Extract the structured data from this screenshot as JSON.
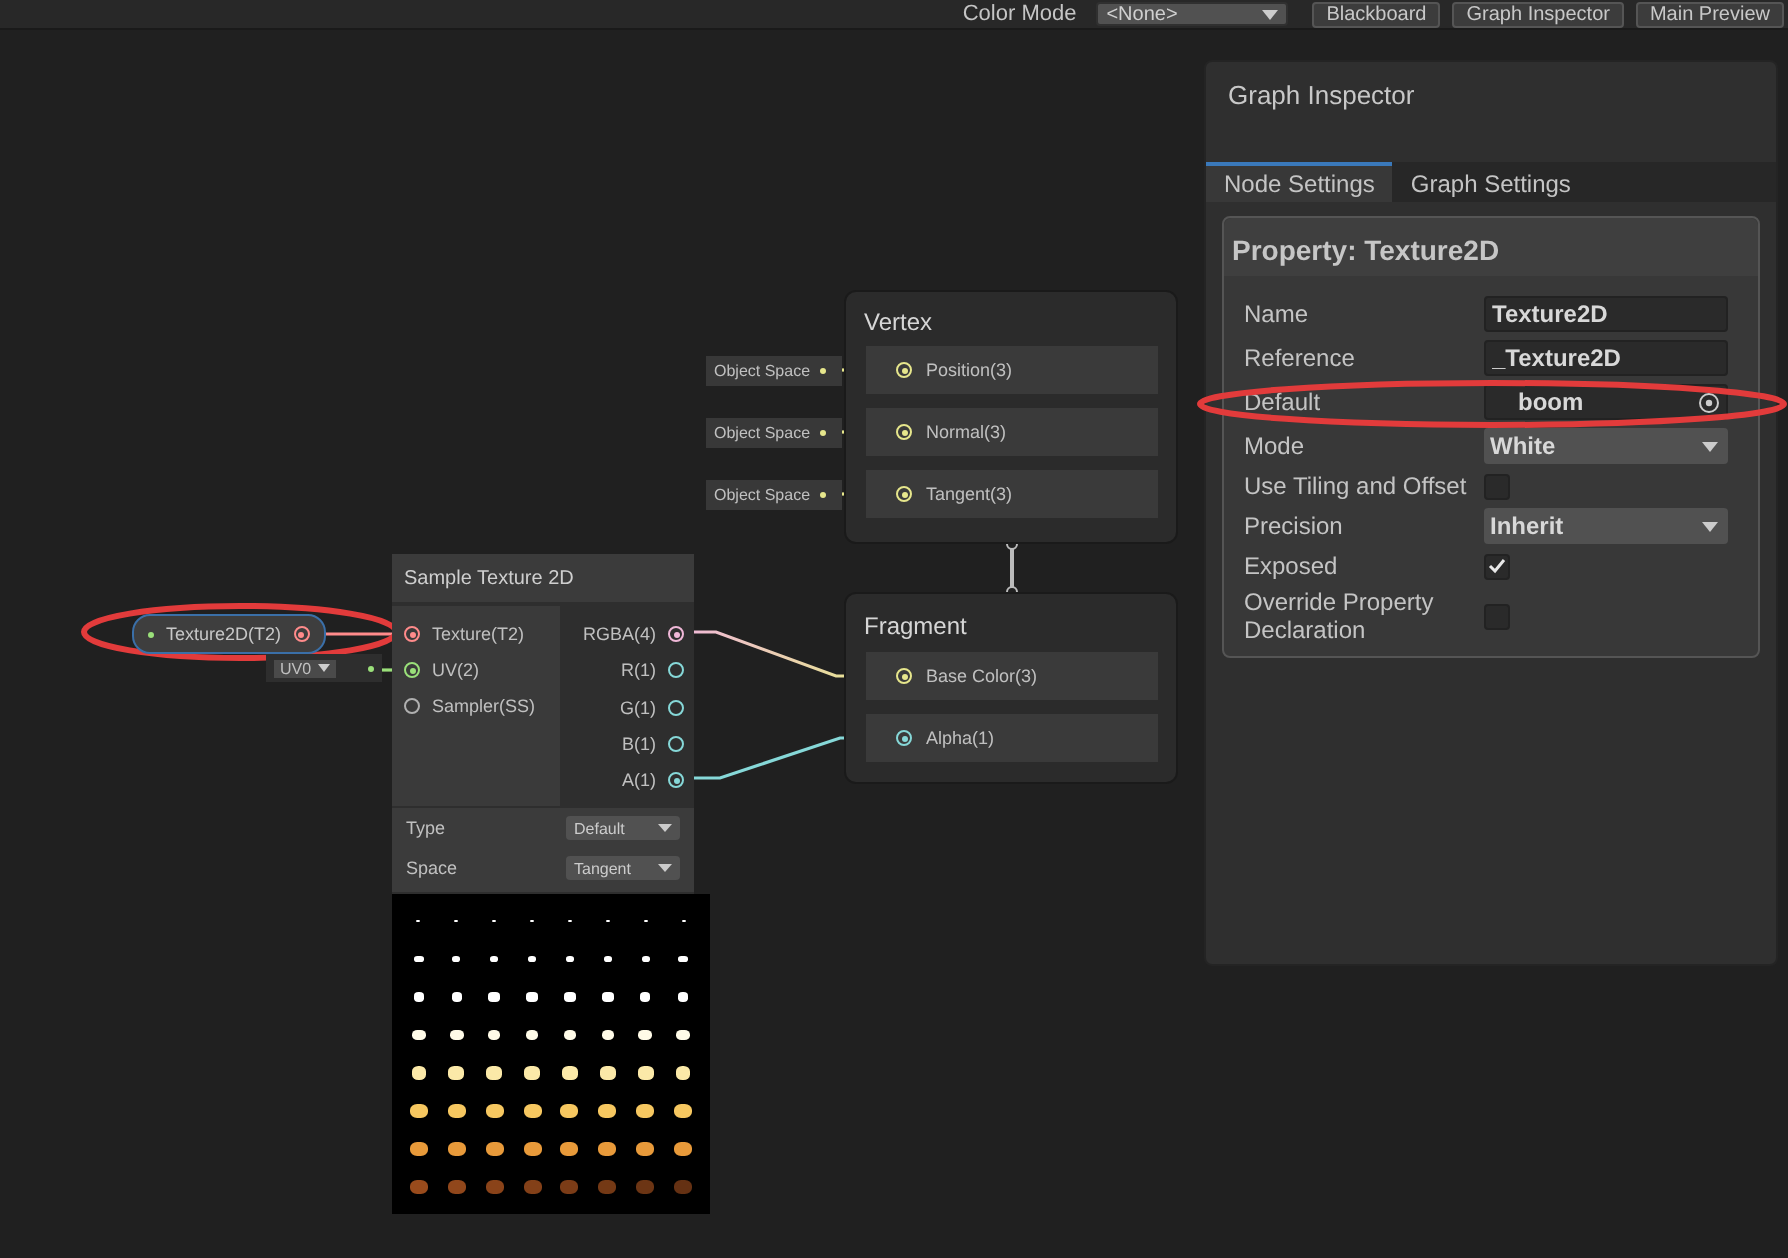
{
  "toolbar": {
    "color_mode_label": "Color Mode",
    "color_mode": "<None>",
    "buttons": [
      "Blackboard",
      "Graph Inspector",
      "Main Preview"
    ]
  },
  "graph": {
    "property_node": {
      "label": "Texture2D(T2)",
      "color": "#ff8b8b"
    },
    "uv_chip": {
      "value": "UV0",
      "color": "#9ae07a"
    },
    "sample_node": {
      "title": "Sample Texture 2D",
      "inputs": [
        {
          "label": "Texture(T2)",
          "color": "#ff8b8b",
          "connected": true
        },
        {
          "label": "UV(2)",
          "color": "#9ae07a",
          "connected": true
        },
        {
          "label": "Sampler(SS)",
          "color": "#b0b0b0",
          "connected": false
        }
      ],
      "outputs": [
        {
          "label": "RGBA(4)",
          "color": "#f0b8d8",
          "connected": true
        },
        {
          "label": "R(1)",
          "color": "#86d8d8",
          "connected": false
        },
        {
          "label": "G(1)",
          "color": "#86d8d8",
          "connected": false
        },
        {
          "label": "B(1)",
          "color": "#86d8d8",
          "connected": false
        },
        {
          "label": "A(1)",
          "color": "#86d8d8",
          "connected": true
        }
      ],
      "settings": [
        {
          "label": "Type",
          "value": "Default"
        },
        {
          "label": "Space",
          "value": "Tangent"
        }
      ]
    },
    "vertex": {
      "title": "Vertex",
      "ports": [
        {
          "label": "Position(3)",
          "input": "Object Space",
          "color": "#e6e68c"
        },
        {
          "label": "Normal(3)",
          "input": "Object Space",
          "color": "#e6e68c"
        },
        {
          "label": "Tangent(3)",
          "input": "Object Space",
          "color": "#e6e68c"
        }
      ]
    },
    "fragment": {
      "title": "Fragment",
      "ports": [
        {
          "label": "Base Color(3)",
          "color": "#e6e68c",
          "connected": true
        },
        {
          "label": "Alpha(1)",
          "color": "#86d8d8",
          "connected": true
        }
      ]
    }
  },
  "inspector": {
    "title": "Graph Inspector",
    "tabs": [
      {
        "label": "Node Settings",
        "selected": true
      },
      {
        "label": "Graph Settings",
        "selected": false
      }
    ],
    "section_title": "Property: Texture2D",
    "rows": [
      {
        "kind": "text",
        "label": "Name",
        "value": "Texture2D"
      },
      {
        "kind": "text",
        "label": "Reference",
        "value": "_Texture2D"
      },
      {
        "kind": "object",
        "label": "Default",
        "value": "boom"
      },
      {
        "kind": "dropdown",
        "label": "Mode",
        "value": "White"
      },
      {
        "kind": "checkbox",
        "label": "Use Tiling and Offset",
        "checked": false
      },
      {
        "kind": "dropdown",
        "label": "Precision",
        "value": "Inherit"
      },
      {
        "kind": "checkbox",
        "label": "Exposed",
        "checked": true
      },
      {
        "kind": "checkbox",
        "label": "Override Property Declaration",
        "checked": false
      }
    ]
  }
}
